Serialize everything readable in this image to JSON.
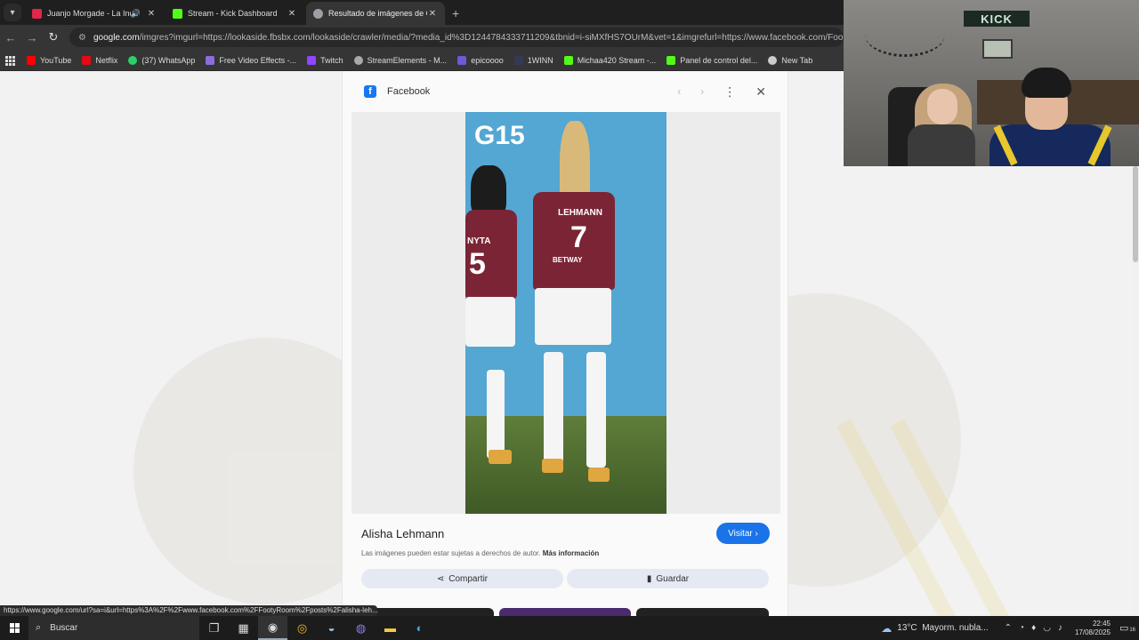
{
  "browser": {
    "tabs": [
      {
        "title": "Juanjo Morgade - La Indep",
        "favicon_color": "#e0264b",
        "active": false,
        "audio": true
      },
      {
        "title": "Stream - Kick Dashboard",
        "favicon_color": "#53fc18",
        "active": false,
        "audio": false
      },
      {
        "title": "Resultado de imágenes de Goo",
        "favicon_color": "#9aa0a6",
        "active": true,
        "audio": false
      }
    ],
    "new_tab_symbol": "+",
    "url_host": "google.com",
    "url_path": "/imgres?imgurl=https://lookaside.fbsbx.com/lookaside/crawler/media/?media_id%3D1244784333711209&tbnid=i-siMXfHS7OUrM&vet=1&imgrefurl=https://www.facebook.com/FootyRoom/po",
    "bookmarks": [
      {
        "label": "YouTube",
        "color": "#ff0000"
      },
      {
        "label": "Netflix",
        "color": "#e50914"
      },
      {
        "label": "(37) WhatsApp",
        "color": "#25d366"
      },
      {
        "label": "Free Video Effects -...",
        "color": "#8e6cdb"
      },
      {
        "label": "Twitch",
        "color": "#9146ff"
      },
      {
        "label": "StreamElements - M...",
        "color": "#aaaaaa"
      },
      {
        "label": "epicoooo",
        "color": "#6b5bd6"
      },
      {
        "label": "1WINN",
        "color": "#333a55"
      },
      {
        "label": "Michaa420 Stream -...",
        "color": "#53fc18"
      },
      {
        "label": "Panel de control del...",
        "color": "#53fc18"
      },
      {
        "label": "New Tab",
        "color": "#cccccc"
      }
    ]
  },
  "viewer": {
    "source": "Facebook",
    "photo_texts": {
      "wall_number": "G15",
      "player_a_name": "LEHMANN",
      "player_a_number": "7",
      "player_b_name": "NYTA",
      "player_b_number": "5",
      "sponsor": "BETWAY"
    },
    "caption": "Alisha Lehmann",
    "visit_label": "Visitar",
    "rights_text": "Las imágenes pueden estar sujetas a derechos de autor.",
    "more_info": "Más información",
    "share_label": "Compartir",
    "save_label": "Guardar"
  },
  "status_link": "https://www.google.com/url?sa=i&url=https%3A%2F%2Fwww.facebook.com%2FFootyRoom%2Fposts%2Falisha-leh...",
  "webcam": {
    "sign_text": "KICK"
  },
  "taskbar": {
    "search_placeholder": "Buscar",
    "weather_temp": "13°C",
    "weather_text": "Mayorm. nubla...",
    "time": "22:45",
    "date": "17/08/2025",
    "notif_count": "16"
  }
}
